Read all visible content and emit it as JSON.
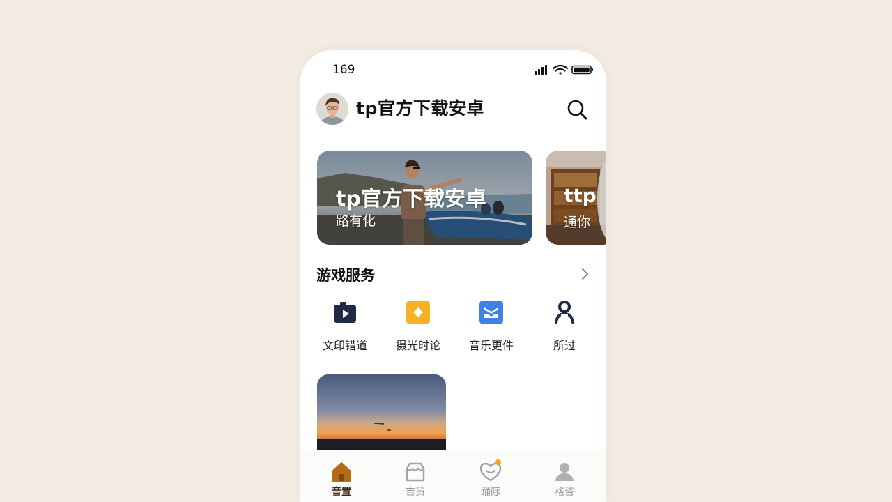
{
  "status_bar": {
    "time": "169"
  },
  "header": {
    "title": "tp官方下载安卓"
  },
  "banners": [
    {
      "title": "tp官方下载安卓",
      "subtitle": "路有化"
    },
    {
      "title": "ttp",
      "subtitle": "通你"
    }
  ],
  "section": {
    "title": "游戏服务"
  },
  "services": [
    {
      "label": "文印错道",
      "icon": "camera-play-icon",
      "color": "#1e2a47"
    },
    {
      "label": "摄光时论",
      "icon": "diamond-tile-icon",
      "color": "#f6b224"
    },
    {
      "label": "音乐更件",
      "icon": "mail-tray-icon",
      "color": "#3e82e6"
    },
    {
      "label": "所过",
      "icon": "person-icon",
      "color": "#1e2a47"
    }
  ],
  "bottom_nav": [
    {
      "label": "音置",
      "icon": "home-icon",
      "active": true
    },
    {
      "label": "吉员",
      "icon": "store-icon",
      "active": false
    },
    {
      "label": "踊际",
      "icon": "heart-badge-icon",
      "active": false,
      "badge": true
    },
    {
      "label": "格咨",
      "icon": "profile-icon",
      "active": false
    }
  ],
  "colors": {
    "background": "#f3ece3",
    "accent_home": "#b46a16",
    "badge": "#f2a51a"
  }
}
